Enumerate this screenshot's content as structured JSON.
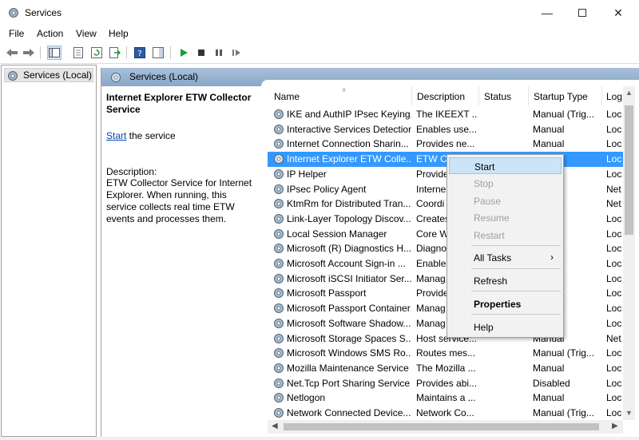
{
  "window": {
    "title": "Services"
  },
  "menu": [
    "File",
    "Action",
    "View",
    "Help"
  ],
  "tree": {
    "root": "Services (Local)"
  },
  "header": {
    "title": "Services (Local)"
  },
  "details": {
    "service_name": "Internet Explorer ETW Collector Service",
    "start_link": "Start",
    "start_suffix": " the service",
    "desc_label": "Description:",
    "desc_text": "ETW Collector Service for Internet Explorer. When running, this service collects real time ETW events and processes them."
  },
  "columns": {
    "name": "Name",
    "description": "Description",
    "status": "Status",
    "startup": "Startup Type",
    "log": "Log"
  },
  "rows": [
    {
      "name": "IKE and AuthIP IPsec Keying...",
      "desc": "The IKEEXT ...",
      "status": "",
      "startup": "Manual (Trig...",
      "log": "Loc"
    },
    {
      "name": "Interactive Services Detection",
      "desc": "Enables use...",
      "status": "",
      "startup": "Manual",
      "log": "Loc"
    },
    {
      "name": "Internet Connection Sharin...",
      "desc": "Provides ne...",
      "status": "",
      "startup": "Manual",
      "log": "Loc"
    },
    {
      "name": "Internet Explorer ETW Colle...",
      "desc": "ETW Co",
      "status": "",
      "startup": "",
      "log": "Loc"
    },
    {
      "name": "IP Helper",
      "desc": "Provide",
      "status": "",
      "startup": "atic",
      "log": "Loc"
    },
    {
      "name": "IPsec Policy Agent",
      "desc": "Interne",
      "status": "",
      "startup": "l (Trig...",
      "log": "Net"
    },
    {
      "name": "KtmRm for Distributed Tran...",
      "desc": "Coordi",
      "status": "",
      "startup": "l (Trig...",
      "log": "Net"
    },
    {
      "name": "Link-Layer Topology Discov...",
      "desc": "Creates",
      "status": "",
      "startup": "l",
      "log": "Loc"
    },
    {
      "name": "Local Session Manager",
      "desc": "Core W",
      "status": "",
      "startup": "atic",
      "log": "Loc"
    },
    {
      "name": "Microsoft (R) Diagnostics H...",
      "desc": "Diagno",
      "status": "",
      "startup": "l",
      "log": "Loc"
    },
    {
      "name": "Microsoft Account Sign-in ...",
      "desc": "Enables",
      "status": "",
      "startup": "l (Trig...",
      "log": "Loc"
    },
    {
      "name": "Microsoft iSCSI Initiator Ser...",
      "desc": "Manag",
      "status": "",
      "startup": "l",
      "log": "Loc"
    },
    {
      "name": "Microsoft Passport",
      "desc": "Provide",
      "status": "",
      "startup": "l (Trig...",
      "log": "Loc"
    },
    {
      "name": "Microsoft Passport Container",
      "desc": "Manag",
      "status": "",
      "startup": "l (Trig...",
      "log": "Loc"
    },
    {
      "name": "Microsoft Software Shadow...",
      "desc": "Manag",
      "status": "",
      "startup": "l",
      "log": "Loc"
    },
    {
      "name": "Microsoft Storage Spaces S...",
      "desc": "Host service...",
      "status": "",
      "startup": "Manual",
      "log": "Net"
    },
    {
      "name": "Microsoft Windows SMS Ro...",
      "desc": "Routes mes...",
      "status": "",
      "startup": "Manual (Trig...",
      "log": "Loc"
    },
    {
      "name": "Mozilla Maintenance Service",
      "desc": "The Mozilla ...",
      "status": "",
      "startup": "Manual",
      "log": "Loc"
    },
    {
      "name": "Net.Tcp Port Sharing Service",
      "desc": "Provides abi...",
      "status": "",
      "startup": "Disabled",
      "log": "Loc"
    },
    {
      "name": "Netlogon",
      "desc": "Maintains a ...",
      "status": "",
      "startup": "Manual",
      "log": "Loc"
    },
    {
      "name": "Network Connected Device...",
      "desc": "Network Co...",
      "status": "",
      "startup": "Manual (Trig...",
      "log": "Loc"
    }
  ],
  "context_menu": {
    "start": "Start",
    "stop": "Stop",
    "pause": "Pause",
    "resume": "Resume",
    "restart": "Restart",
    "all_tasks": "All Tasks",
    "refresh": "Refresh",
    "properties": "Properties",
    "help": "Help"
  },
  "colors": {
    "selection": "#3399ff",
    "header": "#8aa7c8",
    "play": "#1a9c3a"
  }
}
